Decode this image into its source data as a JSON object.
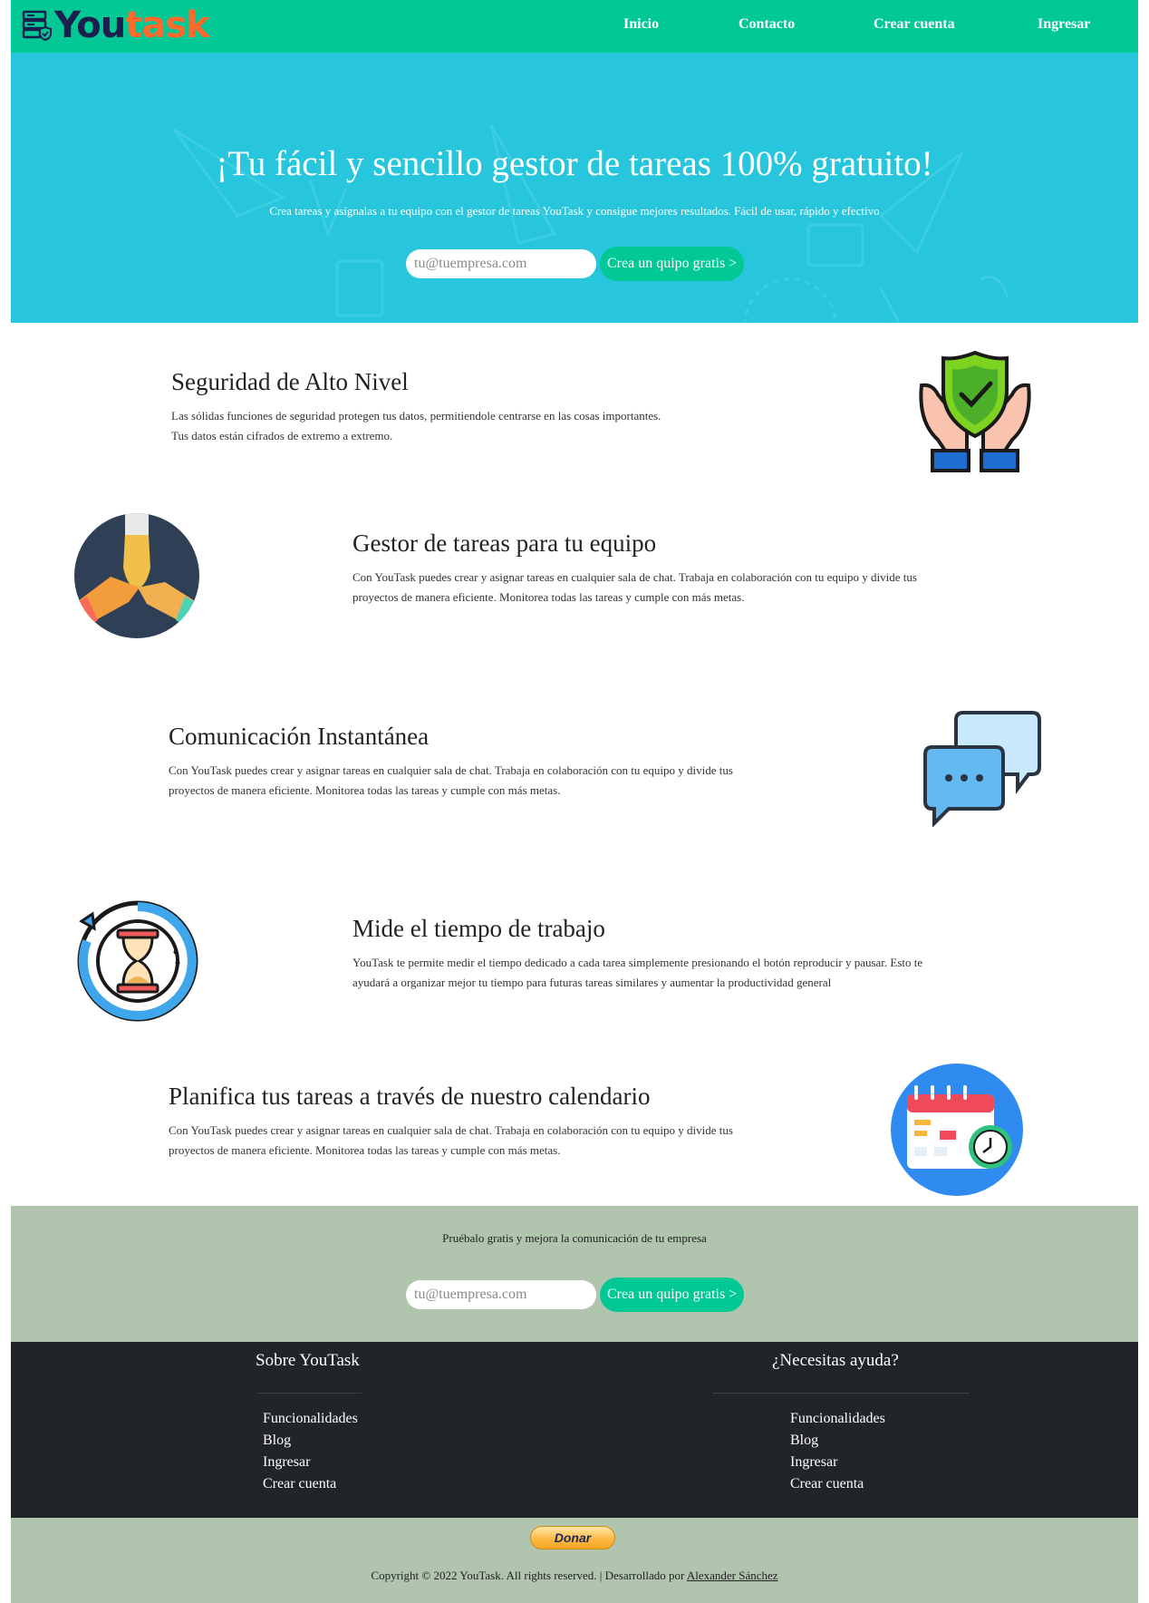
{
  "brand": {
    "logo_you": "You",
    "logo_task": "task"
  },
  "nav": {
    "items": [
      {
        "label": "Inicio"
      },
      {
        "label": "Contacto"
      },
      {
        "label": "Crear cuenta"
      },
      {
        "label": "Ingresar"
      }
    ]
  },
  "hero": {
    "title": "¡Tu fácil y sencillo gestor de tareas 100% gratuito!",
    "subtitle": "Crea tareas y asígnalas a tu equipo con el gestor de tareas YouTask y consigue mejores resultados. Fácil de usar, rápido y efectivo",
    "email_placeholder": "tu@tuempresa.com",
    "cta_label": "Crea un quipo gratis >"
  },
  "features": [
    {
      "title": "Seguridad de Alto Nivel",
      "text_line1": "Las sólidas funciones de seguridad protegen tus datos, permitiendole centrarse en las cosas importantes.",
      "text_line2": "Tus datos están cifrados de extremo a extremo."
    },
    {
      "title": "Gestor de tareas para tu equipo",
      "text_line1": "Con YouTask puedes crear y asignar tareas en cualquier sala de chat. Trabaja en colaboración con tu equipo y divide tus",
      "text_line2": "proyectos de manera eficiente. Monitorea todas las tareas y cumple con más metas."
    },
    {
      "title": "Comunicación Instantánea",
      "text_line1": "Con YouTask puedes crear y asignar tareas en cualquier sala de chat. Trabaja en colaboración con tu equipo y divide tus",
      "text_line2": "proyectos de manera eficiente. Monitorea todas las tareas y cumple con más metas."
    },
    {
      "title": "Mide el tiempo de trabajo",
      "text_line1": "YouTask te permite medir el tiempo dedicado a cada tarea simplemente presionando el botón reproducir y pausar. Esto te",
      "text_line2": "ayudará a organizar mejor tu tiempo para futuras tareas similares y aumentar la productividad general"
    },
    {
      "title": "Planifica tus tareas a través de nuestro calendario",
      "text_line1": "Con YouTask puedes crear y asignar tareas en cualquier sala de chat. Trabaja en colaboración con tu equipo y divide tus",
      "text_line2": "proyectos de manera eficiente. Monitorea todas las tareas y cumple con más metas."
    }
  ],
  "cta": {
    "text": "Pruébalo gratis y mejora la comunicación de tu empresa",
    "email_placeholder": "tu@tuempresa.com",
    "cta_label": "Crea un quipo gratis >"
  },
  "footer": {
    "col1": {
      "title": "Sobre YouTask",
      "links": [
        "Funcionalidades",
        "Blog",
        "Ingresar",
        "Crear cuenta"
      ]
    },
    "col2": {
      "title": "¿Necesitas ayuda?",
      "links": [
        "Funcionalidades",
        "Blog",
        "Ingresar",
        "Crear cuenta"
      ]
    }
  },
  "bottom": {
    "donate_label": "Donar",
    "copyright": "Copyright © 2022 YouTask. All rights reserved. | Desarrollado por",
    "author": "Alexander Sánchez"
  },
  "colors": {
    "nav": "#02c896",
    "hero": "#27c6dc",
    "cta_bg": "#b0c4ae",
    "footer": "#212428",
    "logo_dark": "#1a1f4d",
    "logo_accent": "#ff6a2c"
  }
}
